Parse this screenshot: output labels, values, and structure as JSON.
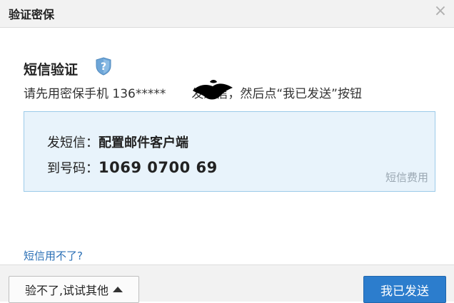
{
  "dialog": {
    "title": "验证密保",
    "close_label": "×"
  },
  "section": {
    "heading": "短信验证",
    "shield_icon": "shield-question-icon",
    "shield_color": "#6ea6d8"
  },
  "instruction": {
    "prefix": "请先用密保手机 136*****",
    "suffix": "发短信，然后点“我已发送”按钮"
  },
  "sms": {
    "content_label": "发短信：",
    "content_value": "配置邮件客户端",
    "number_label": "到号码：",
    "number_value": "1069 0700 69",
    "fee_label": "短信费用"
  },
  "help_link": "短信用不了?",
  "footer": {
    "other_button": "验不了,试试其他",
    "sent_button": "我已发送"
  },
  "colors": {
    "accent": "#2c7dcd",
    "box_bg": "#e8f3fb",
    "box_border": "#9ccbe9",
    "link": "#2a6fb5"
  }
}
